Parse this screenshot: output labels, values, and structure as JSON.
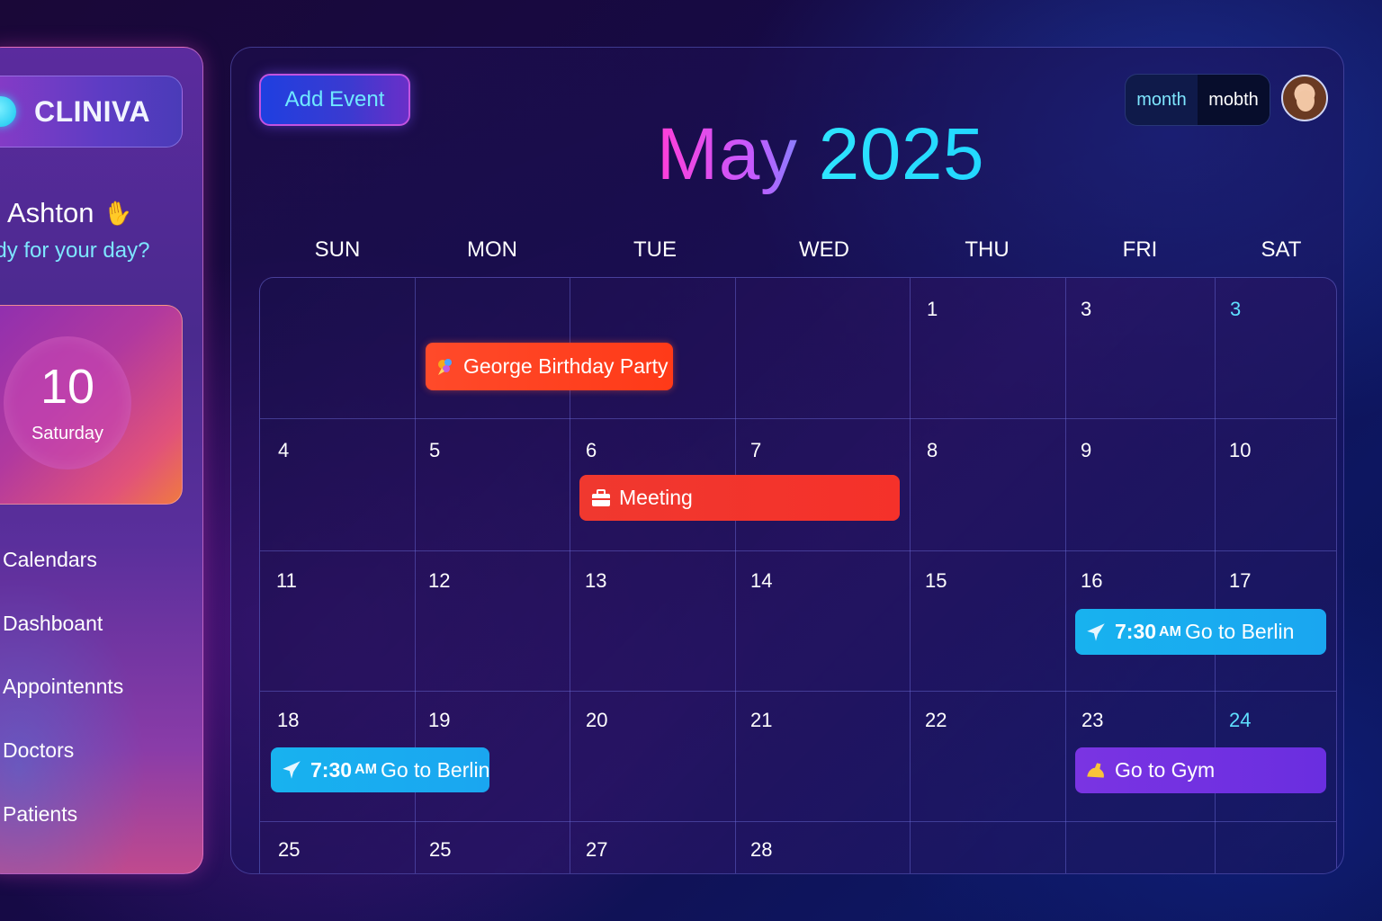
{
  "sidebar": {
    "brand": "CLINIVA",
    "greeting": "Ashton",
    "subgreeting": "ady for your day?",
    "date_card": {
      "day_number": "10",
      "weekday": "Saturday"
    },
    "nav_items": [
      "Calendars",
      "Dashboant",
      "Appointennts",
      "Doctors",
      "Patients"
    ]
  },
  "toolbar": {
    "add_event_label": "Add Event",
    "view_options": [
      "month",
      "mobth"
    ]
  },
  "calendar": {
    "month": "May",
    "year": "2025",
    "weekdays": [
      "SUN",
      "MON",
      "TUE",
      "WED",
      "THU",
      "FRI",
      "SAT"
    ],
    "weeks": [
      [
        "",
        "",
        "",
        "",
        "1",
        "3",
        "3"
      ],
      [
        "4",
        "5",
        "6",
        "7",
        "8",
        "9",
        "10"
      ],
      [
        "11",
        "12",
        "13",
        "14",
        "15",
        "16",
        "17"
      ],
      [
        "18",
        "19",
        "20",
        "21",
        "22",
        "23",
        "24"
      ],
      [
        "25",
        "25",
        "27",
        "28",
        "",
        "",
        ""
      ]
    ],
    "highlighted_days": [
      "3",
      "24"
    ],
    "events": [
      {
        "title": "George Birthday Party",
        "icon": "party-icon"
      },
      {
        "title": "Meeting",
        "icon": "briefcase-icon"
      },
      {
        "time": "7:30",
        "ampm": "AM",
        "title": "Go to Berlin",
        "icon": "plane-icon"
      },
      {
        "time": "7:30",
        "ampm": "AM",
        "title": "Go to Berlin",
        "icon": "plane-icon"
      },
      {
        "title": "Go to Gym",
        "icon": "flexed-arm-icon"
      }
    ]
  },
  "colors": {
    "accent_cyan": "#2ee4ff",
    "accent_magenta": "#ff3ed8",
    "event_red": "#ff3a18",
    "event_blue": "#18b2ef",
    "event_purple": "#7a34e2"
  }
}
